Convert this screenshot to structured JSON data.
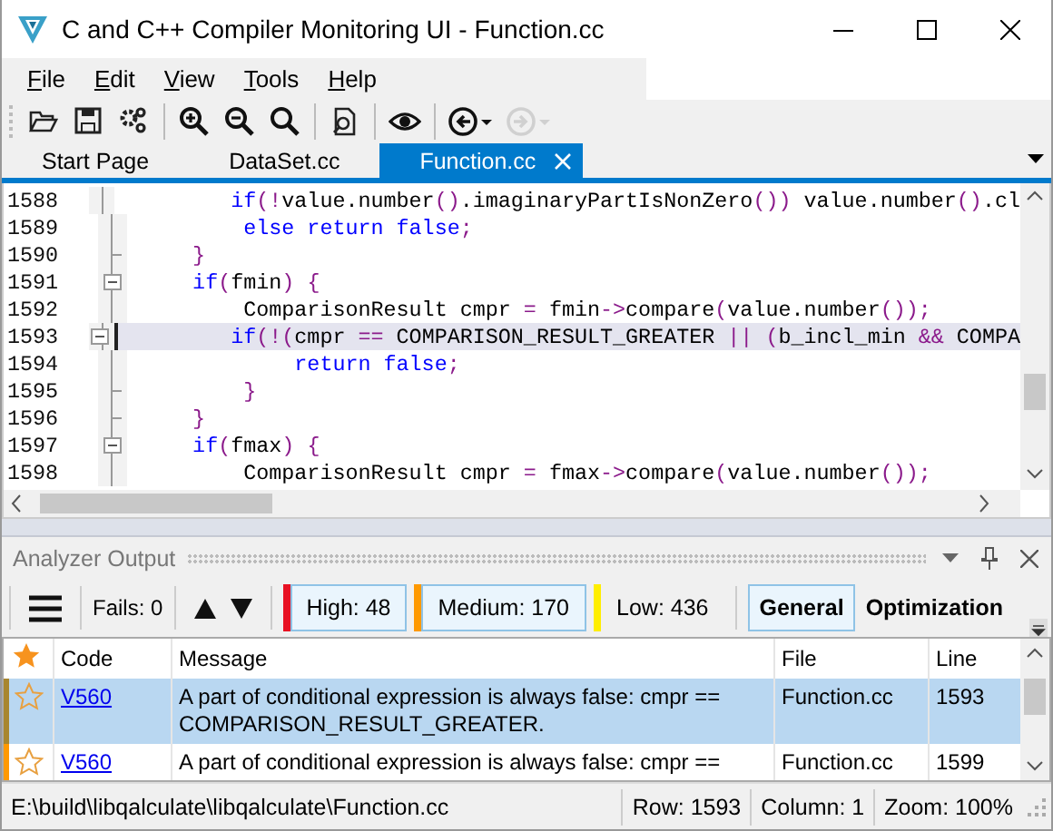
{
  "window": {
    "title": "C and C++ Compiler Monitoring UI - Function.cc"
  },
  "menu": [
    {
      "label": "File"
    },
    {
      "label": "Edit"
    },
    {
      "label": "View"
    },
    {
      "label": "Tools"
    },
    {
      "label": "Help"
    }
  ],
  "toolbar": [
    {
      "kind": "open",
      "disabled": false
    },
    {
      "kind": "save",
      "disabled": false
    },
    {
      "kind": "settings",
      "disabled": false
    },
    {
      "kind": "separator"
    },
    {
      "kind": "zoom-in",
      "disabled": false
    },
    {
      "kind": "zoom-out",
      "disabled": false
    },
    {
      "kind": "zoom",
      "disabled": false
    },
    {
      "kind": "separator"
    },
    {
      "kind": "find-file",
      "disabled": false
    },
    {
      "kind": "separator"
    },
    {
      "kind": "view",
      "disabled": false
    },
    {
      "kind": "separator"
    },
    {
      "kind": "back",
      "disabled": false
    },
    {
      "kind": "forward",
      "disabled": true
    }
  ],
  "tabs": [
    {
      "label": "Start Page",
      "selected": false
    },
    {
      "label": "DataSet.cc",
      "selected": false
    },
    {
      "label": "Function.cc",
      "selected": true
    }
  ],
  "editor": {
    "lines": [
      {
        "number": "1588",
        "foldable": false,
        "block_end": false,
        "current": false,
        "tokens": [
          {
            "kind": "kw",
            "text": "        if"
          },
          {
            "kind": "op",
            "text": "(!"
          },
          {
            "kind": "plain",
            "text": "value.number"
          },
          {
            "kind": "op",
            "text": "()"
          },
          {
            "kind": "plain",
            "text": ".imaginaryPartIsNonZero"
          },
          {
            "kind": "op",
            "text": "())"
          },
          {
            "kind": "plain",
            "text": " value.number"
          },
          {
            "kind": "op",
            "text": "()"
          },
          {
            "kind": "plain",
            "text": ".cl"
          }
        ]
      },
      {
        "number": "1589",
        "foldable": false,
        "block_end": false,
        "current": false,
        "tokens": [
          {
            "kind": "kw",
            "text": "        else return false"
          },
          {
            "kind": "op",
            "text": ";"
          }
        ]
      },
      {
        "number": "1590",
        "foldable": false,
        "block_end": true,
        "current": false,
        "tokens": [
          {
            "kind": "op",
            "text": "    }"
          }
        ]
      },
      {
        "number": "1591",
        "foldable": true,
        "block_end": false,
        "current": false,
        "tokens": [
          {
            "kind": "kw",
            "text": "    if"
          },
          {
            "kind": "op",
            "text": "("
          },
          {
            "kind": "plain",
            "text": "fmin"
          },
          {
            "kind": "op",
            "text": ") {"
          }
        ]
      },
      {
        "number": "1592",
        "foldable": false,
        "block_end": false,
        "current": false,
        "tokens": [
          {
            "kind": "plain",
            "text": "        ComparisonResult cmpr "
          },
          {
            "kind": "op",
            "text": "="
          },
          {
            "kind": "plain",
            "text": " fmin"
          },
          {
            "kind": "op",
            "text": "->"
          },
          {
            "kind": "plain",
            "text": "compare"
          },
          {
            "kind": "op",
            "text": "("
          },
          {
            "kind": "plain",
            "text": "value.number"
          },
          {
            "kind": "op",
            "text": "());"
          }
        ]
      },
      {
        "number": "1593",
        "foldable": true,
        "block_end": false,
        "current": true,
        "tokens": [
          {
            "kind": "kw",
            "text": "        if"
          },
          {
            "kind": "op",
            "text": "(!("
          },
          {
            "kind": "plain",
            "text": "cmpr "
          },
          {
            "kind": "op",
            "text": "=="
          },
          {
            "kind": "plain",
            "text": " COMPARISON_RESULT_GREATER "
          },
          {
            "kind": "op",
            "text": "|| ("
          },
          {
            "kind": "plain",
            "text": "b_incl_min "
          },
          {
            "kind": "op",
            "text": "&&"
          },
          {
            "kind": "plain",
            "text": " COMPA"
          }
        ]
      },
      {
        "number": "1594",
        "foldable": false,
        "block_end": false,
        "current": false,
        "tokens": [
          {
            "kind": "kw",
            "text": "            return false"
          },
          {
            "kind": "op",
            "text": ";"
          }
        ]
      },
      {
        "number": "1595",
        "foldable": false,
        "block_end": true,
        "current": false,
        "tokens": [
          {
            "kind": "op",
            "text": "        }"
          }
        ]
      },
      {
        "number": "1596",
        "foldable": false,
        "block_end": true,
        "current": false,
        "tokens": [
          {
            "kind": "op",
            "text": "    }"
          }
        ]
      },
      {
        "number": "1597",
        "foldable": true,
        "block_end": false,
        "current": false,
        "tokens": [
          {
            "kind": "kw",
            "text": "    if"
          },
          {
            "kind": "op",
            "text": "("
          },
          {
            "kind": "plain",
            "text": "fmax"
          },
          {
            "kind": "op",
            "text": ") {"
          }
        ]
      },
      {
        "number": "1598",
        "foldable": false,
        "block_end": false,
        "current": false,
        "tokens": [
          {
            "kind": "plain",
            "text": "        ComparisonResult cmpr "
          },
          {
            "kind": "op",
            "text": "="
          },
          {
            "kind": "plain",
            "text": " fmax"
          },
          {
            "kind": "op",
            "text": "->"
          },
          {
            "kind": "plain",
            "text": "compare"
          },
          {
            "kind": "op",
            "text": "("
          },
          {
            "kind": "plain",
            "text": "value.number"
          },
          {
            "kind": "op",
            "text": "());"
          }
        ]
      }
    ]
  },
  "analyzer": {
    "title": "Analyzer Output",
    "fails": "Fails: 0",
    "levels": [
      {
        "label": "High: 48",
        "color": "#e81123",
        "selected": true
      },
      {
        "label": "Medium: 170",
        "color": "#ff9900",
        "selected": true
      },
      {
        "label": "Low: 436",
        "color": "#ffee00",
        "selected": false
      }
    ],
    "categories": [
      {
        "label": "General",
        "selected": true
      },
      {
        "label": "Optimization",
        "selected": false
      }
    ],
    "table": {
      "columns": [
        "Code",
        "Message",
        "File",
        "Line"
      ],
      "rows": [
        {
          "code": "V560",
          "message": "A part of conditional expression is always false: cmpr == COMPARISON_RESULT_GREATER.",
          "file": "Function.cc",
          "line": "1593",
          "selected": true,
          "favorite": false
        },
        {
          "code": "V560",
          "message": "A part of conditional expression is always false: cmpr ==",
          "file": "Function.cc",
          "line": "1599",
          "selected": false,
          "favorite": false
        }
      ]
    }
  },
  "status_bar": {
    "path": "E:\\build\\libqalculate\\libqalculate\\Function.cc",
    "row": "Row: 1593",
    "column": "Column: 1",
    "zoom": "Zoom: 100%"
  }
}
